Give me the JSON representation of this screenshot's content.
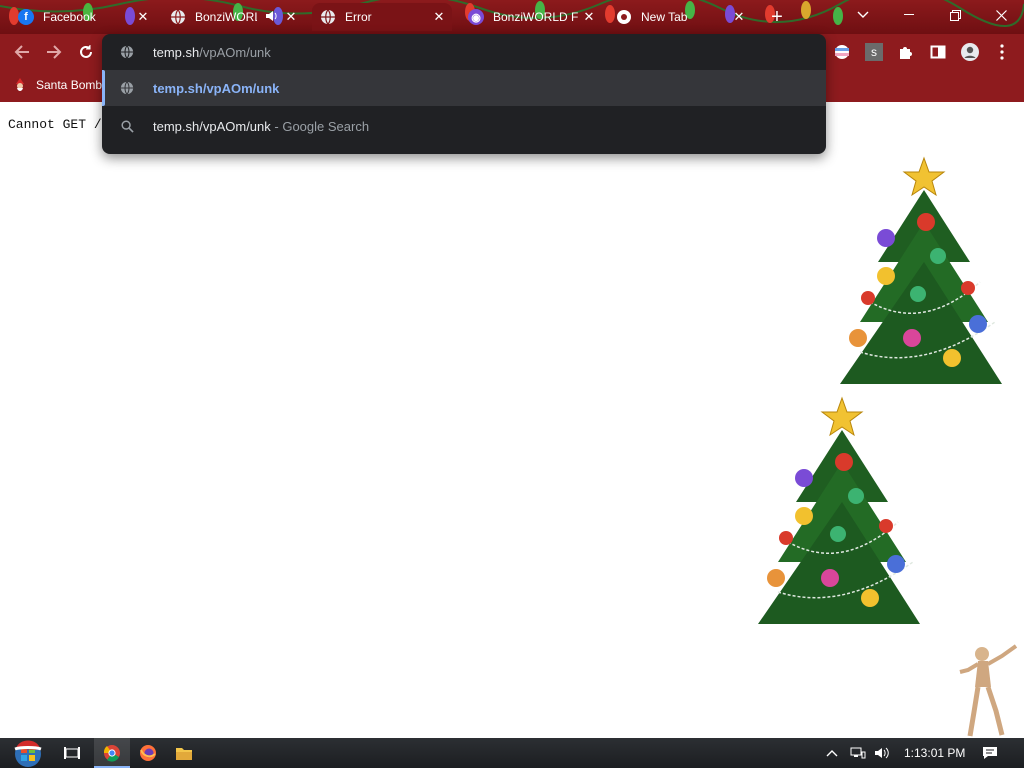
{
  "tabs": [
    {
      "title": "Facebook",
      "icon": "facebook-icon"
    },
    {
      "title": "BonziWORL",
      "icon": "globe-icon",
      "audio_icon": "speaker-icon"
    },
    {
      "title": "Error",
      "icon": "globe-icon",
      "active": true
    },
    {
      "title": "BonziWORLD F",
      "icon": "bonzi-icon"
    },
    {
      "title": "New Tab",
      "icon": "chrome-icon"
    }
  ],
  "tabstrip": {
    "new_tab_icon": "plus-icon",
    "tab_search_icon": "chevron-down-icon",
    "minimize_icon": "minimize-icon",
    "restore_icon": "restore-icon",
    "close_icon": "close-icon",
    "theme_color": "#8c1a1c"
  },
  "toolbar": {
    "back_icon": "back-arrow-icon",
    "forward_icon": "forward-arrow-icon",
    "reload_icon": "reload-icon",
    "extensions": [
      "flag-icon",
      "s-extension-icon",
      "puzzle-icon",
      "side-panel-icon",
      "profile-icon",
      "more-icon"
    ]
  },
  "omnibox": {
    "typed_text": "temp.sh",
    "autocomplete_text": "/vpAOm/unk",
    "suggestions": [
      {
        "text": "temp.sh/vpAOm/unk",
        "suffix": "",
        "icon": "globe-icon",
        "selected": true
      },
      {
        "text": "temp.sh/vpAOm/unk",
        "suffix": " - Google Search",
        "icon": "search-icon",
        "selected": false
      }
    ],
    "accent_color": "#8ab4f8"
  },
  "bookmarks": [
    {
      "label": "Santa Bomb",
      "icon": "santa-icon"
    }
  ],
  "page": {
    "error_text": "Cannot GET /h"
  },
  "desktop_decorations": [
    "christmas-tree-image",
    "christmas-tree-image",
    "dancing-figure-image"
  ],
  "taskbar": {
    "start_icon": "windows-start-icon",
    "items": [
      "task-view-icon",
      "chrome-icon",
      "firefox-icon",
      "file-explorer-icon"
    ],
    "tray_icons": [
      "chevron-up-icon",
      "network-icon",
      "volume-icon"
    ],
    "clock": "1:13:01 PM",
    "notification_icon": "notification-icon"
  }
}
